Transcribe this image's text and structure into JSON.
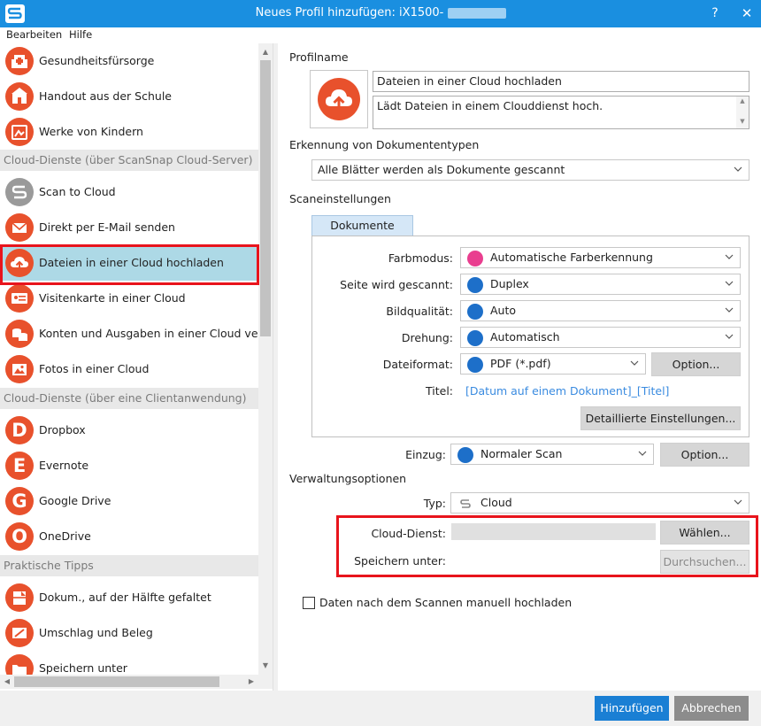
{
  "window": {
    "title": "Neues Profil hinzufügen: iX1500-",
    "help": "?",
    "close": "✕"
  },
  "menu": {
    "edit": "Bearbeiten",
    "help": "Hilfe"
  },
  "list": {
    "items_top": [
      "Gesundheitsfürsorge",
      "Handout aus der Schule",
      "Werke von Kindern"
    ],
    "header_cloud_server": "Cloud-Dienste (über ScanSnap Cloud-Server)",
    "items_cloud": [
      "Scan to Cloud",
      "Direkt per E-Mail senden",
      "Dateien in einer Cloud hochladen",
      "Visitenkarte in einer Cloud",
      "Konten und Ausgaben in einer Cloud verwalten",
      "Fotos in einer Cloud"
    ],
    "header_client_app": "Cloud-Dienste (über eine Clientanwendung)",
    "items_client": [
      {
        "letter": "D",
        "label": "Dropbox"
      },
      {
        "letter": "E",
        "label": "Evernote"
      },
      {
        "letter": "G",
        "label": "Google Drive"
      },
      {
        "letter": "O",
        "label": "OneDrive"
      }
    ],
    "header_tips": "Praktische Tipps",
    "items_tips": [
      "Dokum., auf der Hälfte gefaltet",
      "Umschlag und Beleg",
      "Speichern unter"
    ],
    "selected": "Dateien in einer Cloud hochladen"
  },
  "profile": {
    "section_label": "Profilname",
    "name": "Dateien in einer Cloud hochladen",
    "description": "Lädt Dateien in einem Clouddienst hoch."
  },
  "doctype": {
    "section_label": "Erkennung von Dokumententypen",
    "value": "Alle Blätter werden als Dokumente gescannt"
  },
  "scan": {
    "section_label": "Scaneinstellungen",
    "tab": "Dokumente",
    "color_label": "Farbmodus:",
    "color_value": "Automatische Farberkennung",
    "side_label": "Seite wird gescannt:",
    "side_value": "Duplex",
    "quality_label": "Bildqualität:",
    "quality_value": "Auto",
    "rotation_label": "Drehung:",
    "rotation_value": "Automatisch",
    "format_label": "Dateiformat:",
    "format_value": "PDF (*.pdf)",
    "format_option_btn": "Option...",
    "title_label": "Titel:",
    "title_value": "[Datum auf einem Dokument]_[Titel]",
    "details_btn": "Detaillierte Einstellungen...",
    "feed_label": "Einzug:",
    "feed_value": "Normaler Scan",
    "feed_option_btn": "Option..."
  },
  "manage": {
    "section_label": "Verwaltungsoptionen",
    "type_label": "Typ:",
    "type_value": "Cloud",
    "cloud_label": "Cloud-Dienst:",
    "cloud_value": "",
    "choose_btn": "Wählen...",
    "save_label": "Speichern unter:",
    "browse_btn": "Durchsuchen...",
    "manual_upload": "Daten nach dem Scannen manuell hochladen",
    "manual_upload_checked": false
  },
  "footer": {
    "add": "Hinzufügen",
    "cancel": "Abbrechen"
  },
  "colors": {
    "titlebar": "#1a8fe0",
    "accent": "#e8512c",
    "selection": "#add9e6",
    "highlight": "#e8141c",
    "primary_button": "#1a7fd4"
  }
}
